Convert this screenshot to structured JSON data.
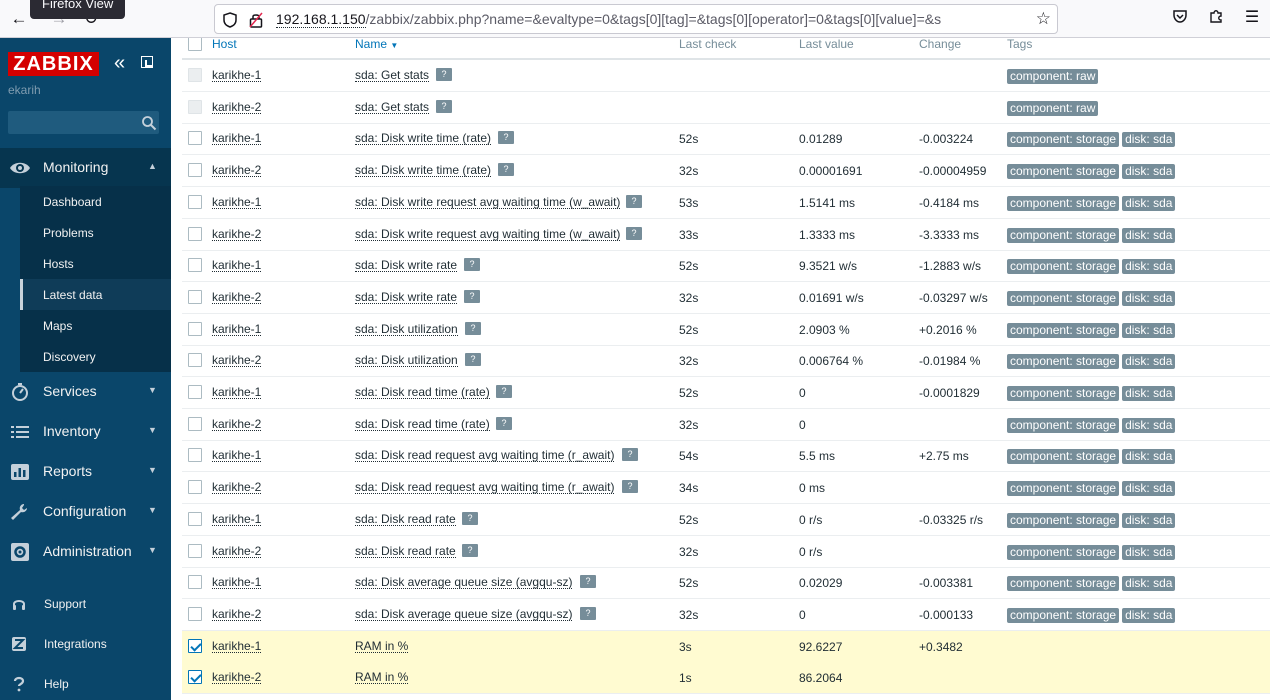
{
  "browser": {
    "tooltip": "Firefox View",
    "url_host": "192.168.1.150",
    "url_path": "/zabbix/zabbix.php?name=&evaltype=0&tags[0][tag]=&tags[0][operator]=0&tags[0][value]=&s"
  },
  "sidebar": {
    "logo": "ZABBIX",
    "user": "ekarih",
    "menu": [
      {
        "label": "Monitoring",
        "icon": "eye-icon"
      },
      {
        "label": "Services",
        "icon": "clock-icon"
      },
      {
        "label": "Inventory",
        "icon": "list-icon"
      },
      {
        "label": "Reports",
        "icon": "bar-chart-icon"
      },
      {
        "label": "Configuration",
        "icon": "wrench-icon"
      },
      {
        "label": "Administration",
        "icon": "gear-icon"
      }
    ],
    "submenu": [
      "Dashboard",
      "Problems",
      "Hosts",
      "Latest data",
      "Maps",
      "Discovery"
    ],
    "active_submenu": "Latest data",
    "bottom": [
      {
        "label": "Support",
        "icon": "headset-icon"
      },
      {
        "label": "Integrations",
        "icon": "integrations-icon"
      },
      {
        "label": "Help",
        "icon": "help-icon"
      }
    ]
  },
  "table": {
    "headers": {
      "host": "Host",
      "name": "Name",
      "last_check": "Last check",
      "last_value": "Last value",
      "change": "Change",
      "tags": "Tags"
    },
    "rows": [
      {
        "host": "karikhe-1",
        "name": "sda: Get stats",
        "last_check": "",
        "last_value": "",
        "change": "",
        "tags": [
          "component: raw"
        ],
        "checkbox": "disabled"
      },
      {
        "host": "karikhe-2",
        "name": "sda: Get stats",
        "last_check": "",
        "last_value": "",
        "change": "",
        "tags": [
          "component: raw"
        ],
        "checkbox": "disabled"
      },
      {
        "host": "karikhe-1",
        "name": "sda: Disk write time (rate)",
        "last_check": "52s",
        "last_value": "0.01289",
        "change": "-0.003224",
        "tags": [
          "component: storage",
          "disk: sda"
        ],
        "checkbox": "unchecked"
      },
      {
        "host": "karikhe-2",
        "name": "sda: Disk write time (rate)",
        "last_check": "32s",
        "last_value": "0.00001691",
        "change": "-0.00004959",
        "tags": [
          "component: storage",
          "disk: sda"
        ],
        "checkbox": "unchecked"
      },
      {
        "host": "karikhe-1",
        "name": "sda: Disk write request avg waiting time (w_await)",
        "last_check": "53s",
        "last_value": "1.5141 ms",
        "change": "-0.4184 ms",
        "tags": [
          "component: storage",
          "disk: sda"
        ],
        "checkbox": "unchecked"
      },
      {
        "host": "karikhe-2",
        "name": "sda: Disk write request avg waiting time (w_await)",
        "last_check": "33s",
        "last_value": "1.3333 ms",
        "change": "-3.3333 ms",
        "tags": [
          "component: storage",
          "disk: sda"
        ],
        "checkbox": "unchecked"
      },
      {
        "host": "karikhe-1",
        "name": "sda: Disk write rate",
        "last_check": "52s",
        "last_value": "9.3521 w/s",
        "change": "-1.2883 w/s",
        "tags": [
          "component: storage",
          "disk: sda"
        ],
        "checkbox": "unchecked"
      },
      {
        "host": "karikhe-2",
        "name": "sda: Disk write rate",
        "last_check": "32s",
        "last_value": "0.01691 w/s",
        "change": "-0.03297 w/s",
        "tags": [
          "component: storage",
          "disk: sda"
        ],
        "checkbox": "unchecked"
      },
      {
        "host": "karikhe-1",
        "name": "sda: Disk utilization",
        "last_check": "52s",
        "last_value": "2.0903 %",
        "change": "+0.2016 %",
        "tags": [
          "component: storage",
          "disk: sda"
        ],
        "checkbox": "unchecked"
      },
      {
        "host": "karikhe-2",
        "name": "sda: Disk utilization",
        "last_check": "32s",
        "last_value": "0.006764 %",
        "change": "-0.01984 %",
        "tags": [
          "component: storage",
          "disk: sda"
        ],
        "checkbox": "unchecked"
      },
      {
        "host": "karikhe-1",
        "name": "sda: Disk read time (rate)",
        "last_check": "52s",
        "last_value": "0",
        "change": "-0.0001829",
        "tags": [
          "component: storage",
          "disk: sda"
        ],
        "checkbox": "unchecked"
      },
      {
        "host": "karikhe-2",
        "name": "sda: Disk read time (rate)",
        "last_check": "32s",
        "last_value": "0",
        "change": "",
        "tags": [
          "component: storage",
          "disk: sda"
        ],
        "checkbox": "unchecked"
      },
      {
        "host": "karikhe-1",
        "name": "sda: Disk read request avg waiting time (r_await)",
        "last_check": "54s",
        "last_value": "5.5 ms",
        "change": "+2.75 ms",
        "tags": [
          "component: storage",
          "disk: sda"
        ],
        "checkbox": "unchecked"
      },
      {
        "host": "karikhe-2",
        "name": "sda: Disk read request avg waiting time (r_await)",
        "last_check": "34s",
        "last_value": "0 ms",
        "change": "",
        "tags": [
          "component: storage",
          "disk: sda"
        ],
        "checkbox": "unchecked"
      },
      {
        "host": "karikhe-1",
        "name": "sda: Disk read rate",
        "last_check": "52s",
        "last_value": "0 r/s",
        "change": "-0.03325 r/s",
        "tags": [
          "component: storage",
          "disk: sda"
        ],
        "checkbox": "unchecked"
      },
      {
        "host": "karikhe-2",
        "name": "sda: Disk read rate",
        "last_check": "32s",
        "last_value": "0 r/s",
        "change": "",
        "tags": [
          "component: storage",
          "disk: sda"
        ],
        "checkbox": "unchecked"
      },
      {
        "host": "karikhe-1",
        "name": "sda: Disk average queue size (avgqu-sz)",
        "last_check": "52s",
        "last_value": "0.02029",
        "change": "-0.003381",
        "tags": [
          "component: storage",
          "disk: sda"
        ],
        "checkbox": "unchecked"
      },
      {
        "host": "karikhe-2",
        "name": "sda: Disk average queue size (avgqu-sz)",
        "last_check": "32s",
        "last_value": "0",
        "change": "-0.000133",
        "tags": [
          "component: storage",
          "disk: sda"
        ],
        "checkbox": "unchecked"
      },
      {
        "host": "karikhe-1",
        "name": "RAM in %",
        "last_check": "3s",
        "last_value": "92.6227",
        "change": "+0.3482",
        "tags": [],
        "checkbox": "checked"
      },
      {
        "host": "karikhe-2",
        "name": "RAM in %",
        "last_check": "1s",
        "last_value": "86.2064",
        "change": "",
        "tags": [],
        "checkbox": "checked"
      }
    ]
  }
}
